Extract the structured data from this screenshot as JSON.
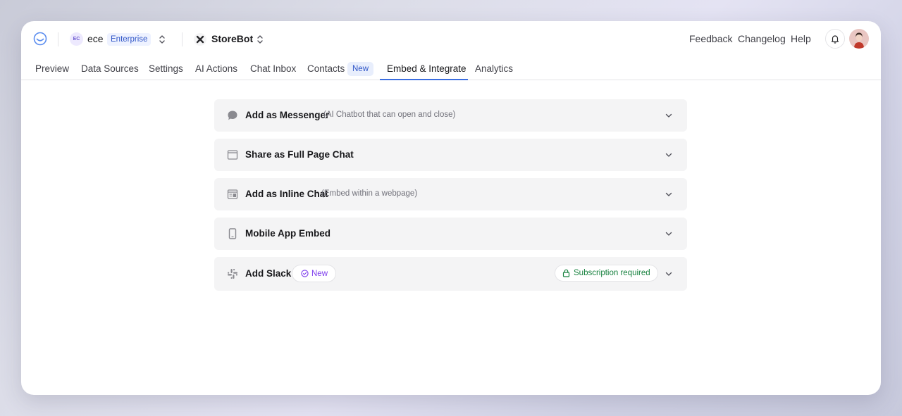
{
  "workspace": {
    "initials": "EC",
    "name": "ece",
    "plan": "Enterprise"
  },
  "bot": {
    "name": "StoreBot"
  },
  "header_links": {
    "feedback": "Feedback",
    "changelog": "Changelog",
    "help": "Help"
  },
  "tabs": [
    {
      "label": "Preview"
    },
    {
      "label": "Data Sources"
    },
    {
      "label": "Settings"
    },
    {
      "label": "AI Actions"
    },
    {
      "label": "Chat Inbox"
    },
    {
      "label": "Contacts",
      "badge": "New"
    },
    {
      "label": "Embed & Integrate",
      "active": true
    },
    {
      "label": "Analytics"
    }
  ],
  "sections": [
    {
      "title": "Add as Messenger",
      "subtitle": "(AI Chatbot that can open and close)",
      "icon": "chat-bubble-icon"
    },
    {
      "title": "Share as Full Page Chat",
      "subtitle": "",
      "icon": "browser-window-icon"
    },
    {
      "title": "Add as Inline Chat",
      "subtitle": "(Embed within a webpage)",
      "icon": "inline-embed-icon"
    },
    {
      "title": "Mobile App Embed",
      "subtitle": "",
      "icon": "mobile-phone-icon"
    },
    {
      "title": "Add Slack",
      "badge": "New",
      "status": "Subscription required",
      "icon": "slack-icon"
    }
  ],
  "colors": {
    "accent": "#3b6ee0",
    "success": "#15803d",
    "new_badge": "#7c3aed"
  }
}
